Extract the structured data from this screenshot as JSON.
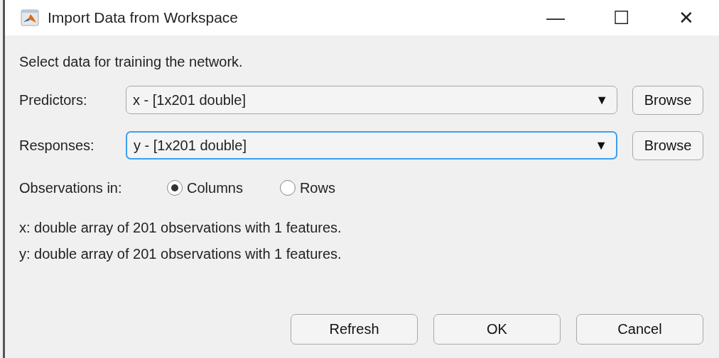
{
  "window": {
    "title": "Import Data from Workspace",
    "controls": [
      "—",
      "☐",
      "✕"
    ]
  },
  "instruction": "Select data for training the network.",
  "fields": [
    {
      "label": "Predictors:",
      "value": "x - [1x201 double]",
      "arrow": "▼",
      "focused": false,
      "button": "Browse"
    },
    {
      "label": "Responses:",
      "value": "y - [1x201 double]",
      "arrow": "▼",
      "focused": true,
      "button": "Browse"
    }
  ],
  "observations": {
    "label": "Observations in:",
    "options": [
      {
        "label": "Columns",
        "selected": true
      },
      {
        "label": "Rows",
        "selected": false
      }
    ]
  },
  "info": [
    "x: double array of 201 observations with 1 features.",
    "y: double array of 201 observations with 1 features."
  ],
  "buttons": [
    "Refresh",
    "OK",
    "Cancel"
  ]
}
